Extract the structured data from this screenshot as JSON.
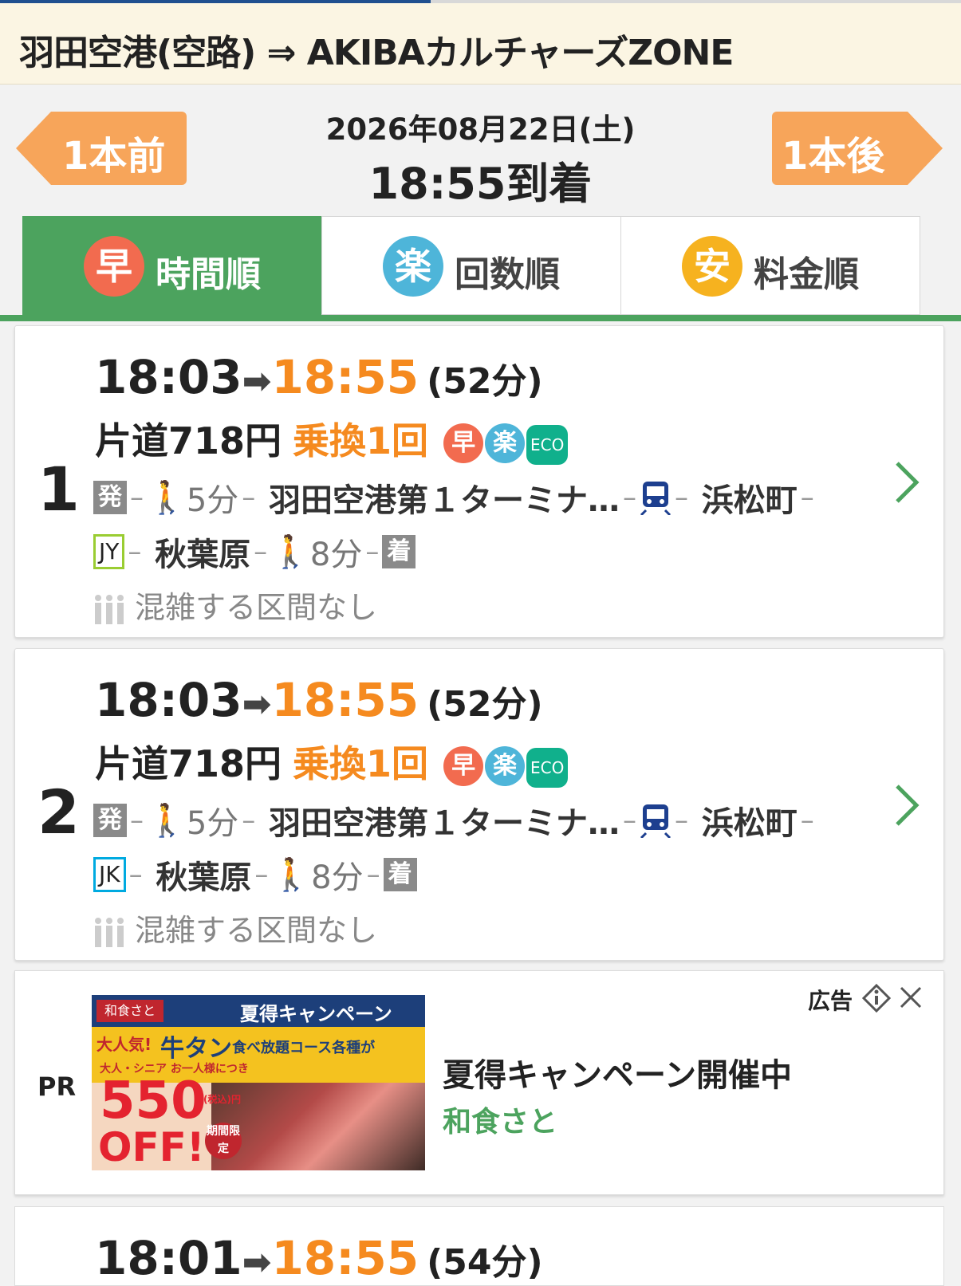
{
  "header": {
    "title": "羽田空港(空路) ⇒ AKIBAカルチャーズZONE"
  },
  "nav": {
    "prev_label": "1本前",
    "next_label": "1本後",
    "date": "2026年08月22日(土)",
    "arrival": "18:55到着"
  },
  "tabs": [
    {
      "badge": "早",
      "label": "時間順",
      "color": "#f26b4f",
      "active": true
    },
    {
      "badge": "楽",
      "label": "回数順",
      "color": "#4eb5d9",
      "active": false
    },
    {
      "badge": "安",
      "label": "料金順",
      "color": "#f6b21f",
      "active": false
    }
  ],
  "routes": [
    {
      "rank": "1",
      "dep": "18:03",
      "arr": "18:55",
      "duration": "(52分)",
      "fare": "片道718円",
      "transfers": "乗換1回",
      "badges": {
        "fast": "早",
        "easy": "楽",
        "eco": "ECO"
      },
      "dep_tag": "発",
      "walk1": "5分",
      "station1": "羽田空港第１ターミナ…",
      "station2": "浜松町",
      "line_code": "JY",
      "station3": "秋葉原",
      "walk2": "8分",
      "arr_tag": "着",
      "crowd": "混雑する区間なし"
    },
    {
      "rank": "2",
      "dep": "18:03",
      "arr": "18:55",
      "duration": "(52分)",
      "fare": "片道718円",
      "transfers": "乗換1回",
      "badges": {
        "fast": "早",
        "easy": "楽",
        "eco": "ECO"
      },
      "dep_tag": "発",
      "walk1": "5分",
      "station1": "羽田空港第１ターミナ…",
      "station2": "浜松町",
      "line_code": "JK",
      "station3": "秋葉原",
      "walk2": "8分",
      "arr_tag": "着",
      "crowd": "混雑する区間なし"
    },
    {
      "dep": "18:01",
      "arr": "18:55",
      "duration": "(54分)"
    }
  ],
  "ad": {
    "pr": "PR",
    "label": "広告",
    "title": "夏得キャンペーン開催中",
    "sponsor": "和食さと",
    "banner": {
      "brand": "和食さと",
      "campaign": "夏得キャンペーン",
      "popular": "大人気!",
      "item": "牛タン",
      "course": "食べ放題コース各種が",
      "target": "大人・シニア お一人様につき",
      "price": "550",
      "yen": "(税込)円",
      "off": "OFF!",
      "limited": "期間限定"
    }
  },
  "colors": {
    "accent_green": "#4ca35e",
    "orange": "#f58a1f",
    "nav_orange": "#f7a55a"
  }
}
